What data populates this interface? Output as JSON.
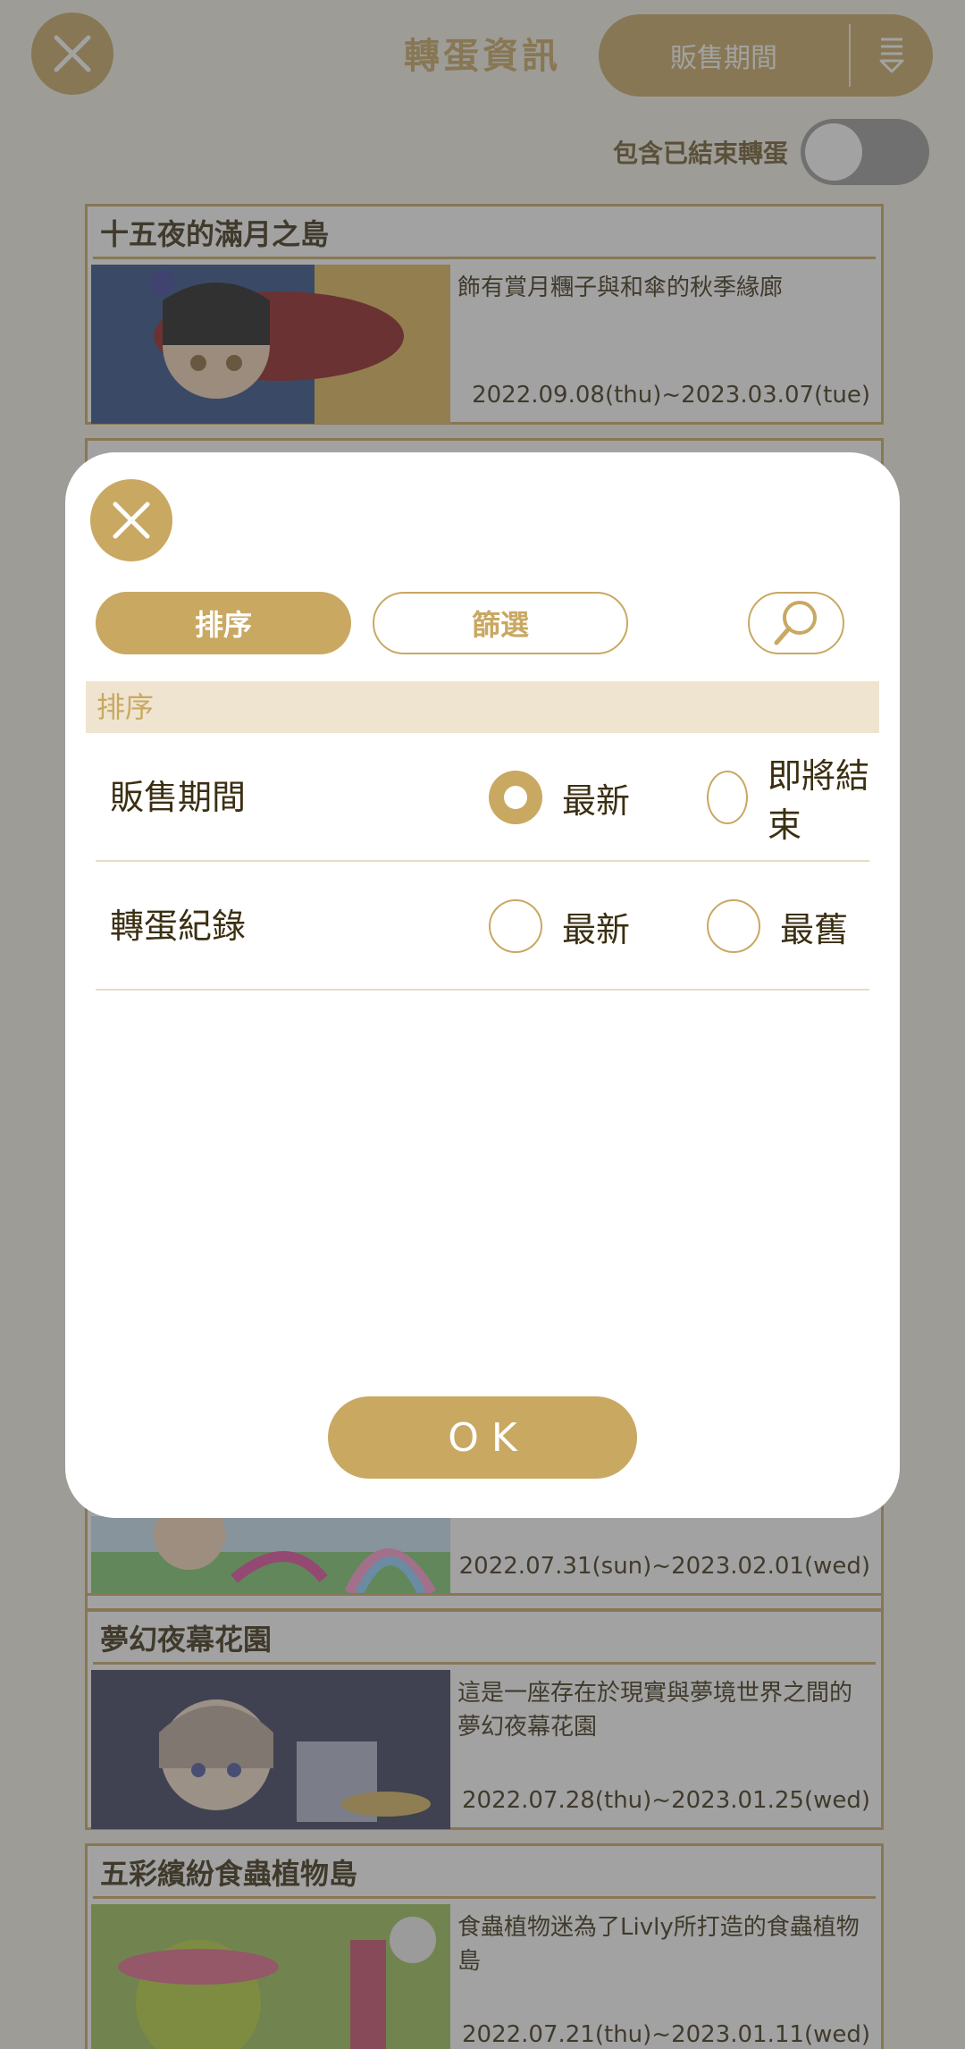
{
  "header": {
    "title": "轉蛋資訊",
    "sort_label": "販售期間",
    "close_icon": "close-icon",
    "sort_icon": "sort-list-icon"
  },
  "toggle": {
    "label": "包含已結束轉蛋",
    "state": "off"
  },
  "cards": [
    {
      "title": "十五夜的滿月之島",
      "desc": "飾有賞月糰子與和傘的秋季緣廊",
      "date": "2022.09.08(thu)~2023.03.07(tue)"
    },
    {
      "title": "",
      "desc": "",
      "date": "2022.07.31(sun)~2023.02.01(wed)"
    },
    {
      "title": "夢幻夜幕花園",
      "desc": "這是一座存在於現實與夢境世界之間的夢幻夜幕花園",
      "date": "2022.07.28(thu)~2023.01.25(wed)"
    },
    {
      "title": "五彩繽紛食蟲植物島",
      "desc": "食蟲植物迷為了Livly所打造的食蟲植物島",
      "date": "2022.07.21(thu)~2023.01.11(wed)"
    }
  ],
  "modal": {
    "tabs": {
      "sort": "排序",
      "filter": "篩選"
    },
    "section_title": "排序",
    "rows": [
      {
        "label": "販售期間",
        "opt1": "最新",
        "opt2": "即將結束",
        "selected": "最新"
      },
      {
        "label": "轉蛋紀錄",
        "opt1": "最新",
        "opt2": "最舊",
        "selected": ""
      }
    ],
    "ok_label": "OK",
    "accent": "#c9a862"
  }
}
